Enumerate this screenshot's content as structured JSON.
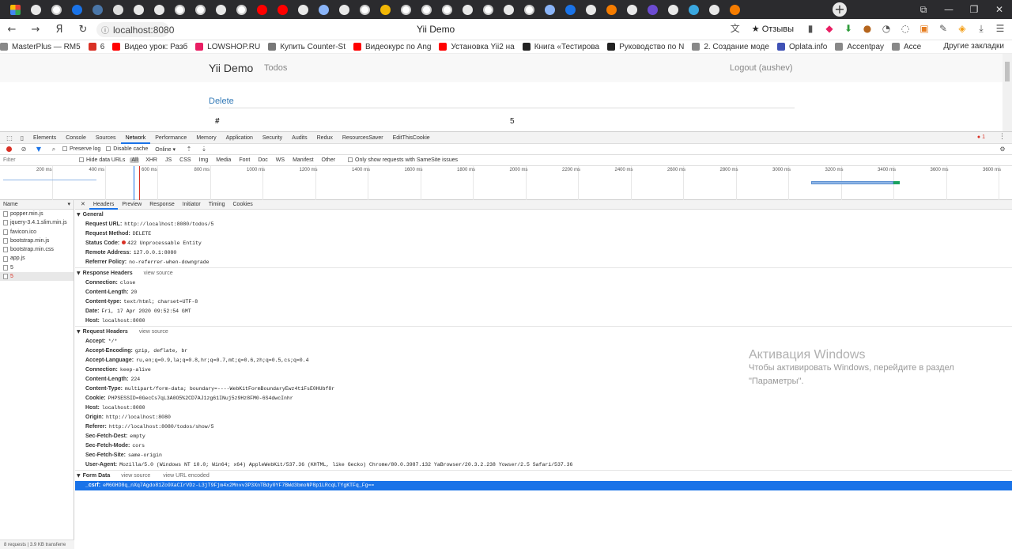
{
  "browser": {
    "page_title": "Yii Demo",
    "address": "localhost:8080",
    "reviews_label": "★ Отзывы",
    "tab_icons": [
      "yandex-logo",
      "google",
      "github",
      "opera",
      "vk",
      "doc",
      "google",
      "google",
      "github",
      "github",
      "google",
      "github",
      "youtube",
      "youtube",
      "google",
      "photo",
      "google",
      "github",
      "gear",
      "github",
      "github",
      "github",
      "google",
      "github",
      "google",
      "github",
      "photo",
      "opera",
      "google",
      "fire",
      "google",
      "bold",
      "google",
      "yii",
      "google",
      "fire"
    ],
    "bookmarks": [
      {
        "label": "MasterPlus — RM5",
        "color": "#888888"
      },
      {
        "label": "6",
        "color": "#d93025"
      },
      {
        "label": "Видео урок: Разб",
        "color": "#ff0000"
      },
      {
        "label": "LOWSHOP.RU",
        "color": "#e91e63"
      },
      {
        "label": "Купить Counter-St",
        "color": "#777777"
      },
      {
        "label": "Видеокурс по Ang",
        "color": "#ff0000"
      },
      {
        "label": "Установка Yii2 на",
        "color": "#ff0000"
      },
      {
        "label": "Книга «Тестирова",
        "color": "#222222"
      },
      {
        "label": "Руководство по N",
        "color": "#222222"
      },
      {
        "label": "2. Создание моде",
        "color": "#888888"
      },
      {
        "label": "Oplata.info",
        "color": "#3f51b5"
      },
      {
        "label": "Accentpay",
        "color": "#888888"
      },
      {
        "label": "Acce",
        "color": "#888888"
      }
    ],
    "bookmarks_more": "Другие закладки"
  },
  "page": {
    "brand": "Yii Demo",
    "nav_todos": "Todos",
    "logout": "Logout (aushev)",
    "delete_link": "Delete",
    "row_label": "#",
    "row_value": "5"
  },
  "devtools": {
    "tabs": [
      "Elements",
      "Console",
      "Sources",
      "Network",
      "Performance",
      "Memory",
      "Application",
      "Security",
      "Audits",
      "Redux",
      "ResourcesSaver",
      "EditThisCookie"
    ],
    "active_tab": "Network",
    "error_count": "1",
    "toolbar": {
      "preserve_log": "Preserve log",
      "disable_cache": "Disable cache",
      "throttle": "Online"
    },
    "filter": {
      "placeholder": "Filter",
      "hide_data_urls": "Hide data URLs",
      "types": [
        "All",
        "XHR",
        "JS",
        "CSS",
        "Img",
        "Media",
        "Font",
        "Doc",
        "WS",
        "Manifest",
        "Other"
      ],
      "samesite": "Only show requests with SameSite issues"
    },
    "timeline_ticks": [
      "200 ms",
      "400 ms",
      "600 ms",
      "800 ms",
      "1000 ms",
      "1200 ms",
      "1400 ms",
      "1600 ms",
      "1800 ms",
      "2000 ms",
      "2200 ms",
      "2400 ms",
      "2600 ms",
      "2800 ms",
      "3000 ms",
      "3200 ms",
      "3400 ms",
      "3600 ms",
      "3600 ms"
    ],
    "name_header": "Name",
    "files": [
      {
        "name": "popper.min.js",
        "err": false
      },
      {
        "name": "jquery-3.4.1.slim.min.js",
        "err": false
      },
      {
        "name": "favicon.ico",
        "err": false
      },
      {
        "name": "bootstrap.min.js",
        "err": false
      },
      {
        "name": "bootstrap.min.css",
        "err": false
      },
      {
        "name": "app.js",
        "err": false
      },
      {
        "name": "5",
        "err": false
      },
      {
        "name": "5",
        "err": true
      }
    ],
    "status_bar": "8 requests | 3.9 KB transferre",
    "detail_tabs": [
      "Headers",
      "Preview",
      "Response",
      "Initiator",
      "Timing",
      "Cookies"
    ],
    "active_detail_tab": "Headers",
    "view_source": "view source",
    "view_url_encoded": "view URL encoded",
    "general": {
      "title": "General",
      "rows": [
        {
          "k": "Request URL:",
          "v": "http://localhost:8080/todos/5"
        },
        {
          "k": "Request Method:",
          "v": "DELETE"
        },
        {
          "k": "Status Code:",
          "v": "422 Unprocessable Entity"
        },
        {
          "k": "Remote Address:",
          "v": "127.0.0.1:8080"
        },
        {
          "k": "Referrer Policy:",
          "v": "no-referrer-when-downgrade"
        }
      ]
    },
    "response_headers": {
      "title": "Response Headers",
      "rows": [
        {
          "k": "Connection:",
          "v": "close"
        },
        {
          "k": "Content-Length:",
          "v": "20"
        },
        {
          "k": "Content-type:",
          "v": "text/html; charset=UTF-8"
        },
        {
          "k": "Date:",
          "v": "Fri, 17 Apr 2020 09:52:54 GMT"
        },
        {
          "k": "Host:",
          "v": "localhost:8080"
        }
      ]
    },
    "request_headers": {
      "title": "Request Headers",
      "rows": [
        {
          "k": "Accept:",
          "v": "*/*"
        },
        {
          "k": "Accept-Encoding:",
          "v": "gzip, deflate, br"
        },
        {
          "k": "Accept-Language:",
          "v": "ru,en;q=0.9,la;q=0.8,hr;q=0.7,mt;q=0.6,zh;q=0.5,cs;q=0.4"
        },
        {
          "k": "Connection:",
          "v": "keep-alive"
        },
        {
          "k": "Content-Length:",
          "v": "224"
        },
        {
          "k": "Content-Type:",
          "v": "multipart/form-data; boundary=----WebKitFormBoundaryEwz4t1FsE0HUbf8r"
        },
        {
          "k": "Cookie:",
          "v": "PHPSESSID=0GecCs7qL3A0O5%2CD7AJ1zg61INuj5z9Hz8FM0-6S4dwcInhr"
        },
        {
          "k": "Host:",
          "v": "localhost:8080"
        },
        {
          "k": "Origin:",
          "v": "http://localhost:8080"
        },
        {
          "k": "Referer:",
          "v": "http://localhost:8080/todos/show/5"
        },
        {
          "k": "Sec-Fetch-Dest:",
          "v": "empty"
        },
        {
          "k": "Sec-Fetch-Mode:",
          "v": "cors"
        },
        {
          "k": "Sec-Fetch-Site:",
          "v": "same-origin"
        },
        {
          "k": "User-Agent:",
          "v": "Mozilla/5.0 (Windows NT 10.0; Win64; x64) AppleWebKit/537.36 (KHTML, like Gecko) Chrome/80.0.3987.132 YaBrowser/20.3.2.238 Yowser/2.5 Safari/537.36"
        }
      ]
    },
    "form_data": {
      "title": "Form Data",
      "rows": [
        {
          "k": "_csrf:",
          "v": "eM6GHD8q_nXq7Agdo81Zo9XaCIrVDz-L3jT9Fjm4x2Mnvv3P3XnTBdy0YF7BWd3bmoNP8p1LRcqLTYgKTFq_Fg=="
        }
      ]
    }
  },
  "activation": {
    "title": "Активация Windows",
    "line1": "Чтобы активировать Windows, перейдите в раздел",
    "line2": "\"Параметры\"."
  },
  "colors": {
    "accent": "#1a73e8",
    "error": "#d93025",
    "link": "#337ab7"
  }
}
